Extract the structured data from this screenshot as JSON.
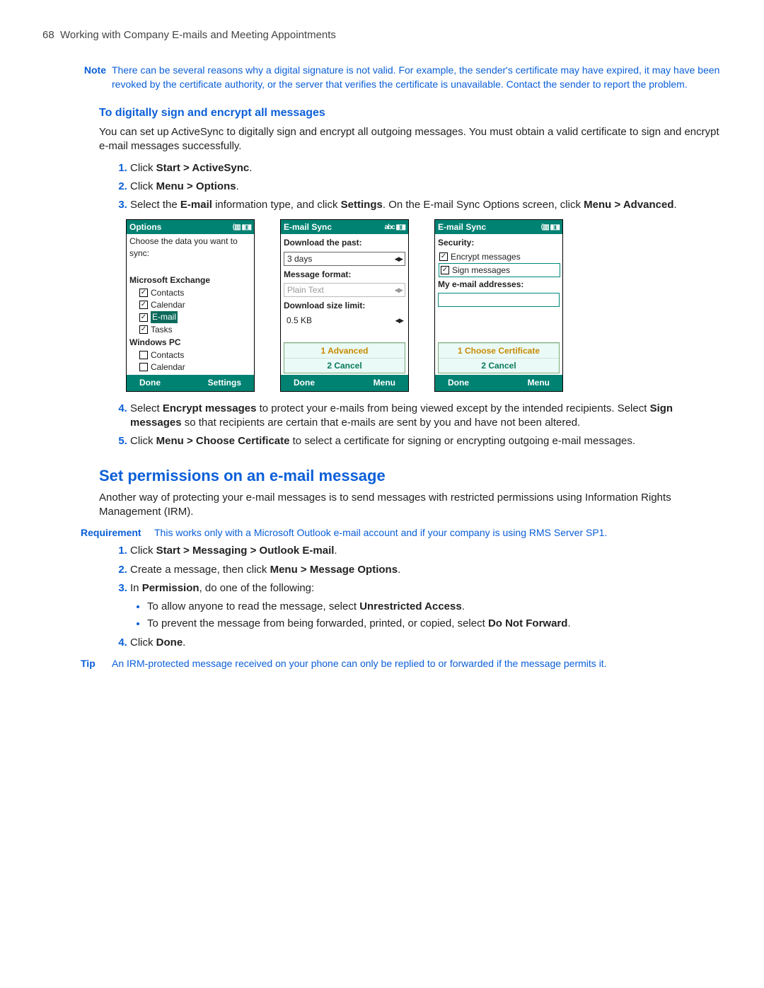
{
  "header": {
    "page_no": "68",
    "title": "Working with Company E-mails and Meeting Appointments"
  },
  "note": {
    "label": "Note",
    "body": "There can be several reasons why a digital signature is not valid. For example, the sender's certificate may have expired, it may have been revoked by the certificate authority, or the server that verifies the certificate is unavailable. Contact the sender to report the problem."
  },
  "sec1": {
    "heading": "To digitally sign and encrypt all messages",
    "intro": "You can set up ActiveSync to digitally sign and encrypt all outgoing messages. You must obtain a valid certificate to sign and encrypt e-mail messages successfully.",
    "step1_pre": "Click ",
    "step1_b": "Start > ActiveSync",
    "step1_post": ".",
    "step2_pre": "Click ",
    "step2_b": "Menu > Options",
    "step2_post": ".",
    "step3_pre": "Select the ",
    "step3_b1": "E-mail",
    "step3_mid": " information type, and click ",
    "step3_b2": "Settings",
    "step3_mid2": ". On the E-mail Sync Options screen, click ",
    "step3_b3": "Menu > Advanced",
    "step3_post": ".",
    "step4_pre": "Select ",
    "step4_b1": "Encrypt messages",
    "step4_mid": " to protect your e-mails from being viewed except by the intended recipients. Select ",
    "step4_b2": "Sign messages",
    "step4_post": " so that recipients are certain that e-mails are sent by you and have not been altered.",
    "step5_pre": "Click ",
    "step5_b": "Menu > Choose Certificate",
    "step5_post": " to select a certificate for signing or encrypting outgoing e-mail messages."
  },
  "shots": {
    "s1": {
      "title": "Options",
      "ind": "⟨▥ ▮▯▮",
      "choose": "Choose the data you want to sync:",
      "exch": "Microsoft Exchange",
      "itemsE": [
        "Contacts",
        "Calendar",
        "E-mail",
        "Tasks"
      ],
      "pc": "Windows PC",
      "itemsP": [
        "Contacts",
        "Calendar"
      ],
      "left": "Done",
      "right": "Settings"
    },
    "s2": {
      "title": "E-mail Sync",
      "ind": "abc ▮▯▮",
      "l1": "Download the past:",
      "v1": "3 days",
      "l2": "Message format:",
      "v2": "Plain Text",
      "l3": "Download size limit:",
      "v3": "0.5 KB",
      "m1": "1 Advanced",
      "m2": "2 Cancel",
      "left": "Done",
      "right": "Menu"
    },
    "s3": {
      "title": "E-mail Sync",
      "ind": "⟨▥ ▮▯▮",
      "sec": "Security:",
      "opt1": "Encrypt messages",
      "opt2": "Sign messages",
      "addr": "My e-mail addresses:",
      "m1": "1 Choose Certificate",
      "m2": "2 Cancel",
      "left": "Done",
      "right": "Menu"
    }
  },
  "sec2": {
    "heading": "Set permissions on an e-mail message",
    "intro": "Another way of protecting your e-mail messages is to send messages with restricted permissions using Information Rights Management (IRM).",
    "req_label": "Requirement",
    "req_body": "This works only with a Microsoft Outlook e-mail account and if your company is using RMS Server SP1.",
    "step1_pre": "Click ",
    "step1_b": "Start > Messaging > Outlook E-mail",
    "step1_post": ".",
    "step2_pre": "Create a message, then click ",
    "step2_b": "Menu > Message Options",
    "step2_post": ".",
    "step3_pre": "In ",
    "step3_b": "Permission",
    "step3_post": ", do one of the following:",
    "b1_pre": "To allow anyone to read the message, select ",
    "b1_b": "Unrestricted Access",
    "b1_post": ".",
    "b2_pre": "To prevent the message from being forwarded, printed, or copied, select ",
    "b2_b": "Do Not Forward",
    "b2_post": ".",
    "step4_pre": "Click ",
    "step4_b": "Done",
    "step4_post": "."
  },
  "tip": {
    "label": "Tip",
    "body": "An IRM-protected message received on your phone can only be replied to or forwarded if the message permits it."
  }
}
